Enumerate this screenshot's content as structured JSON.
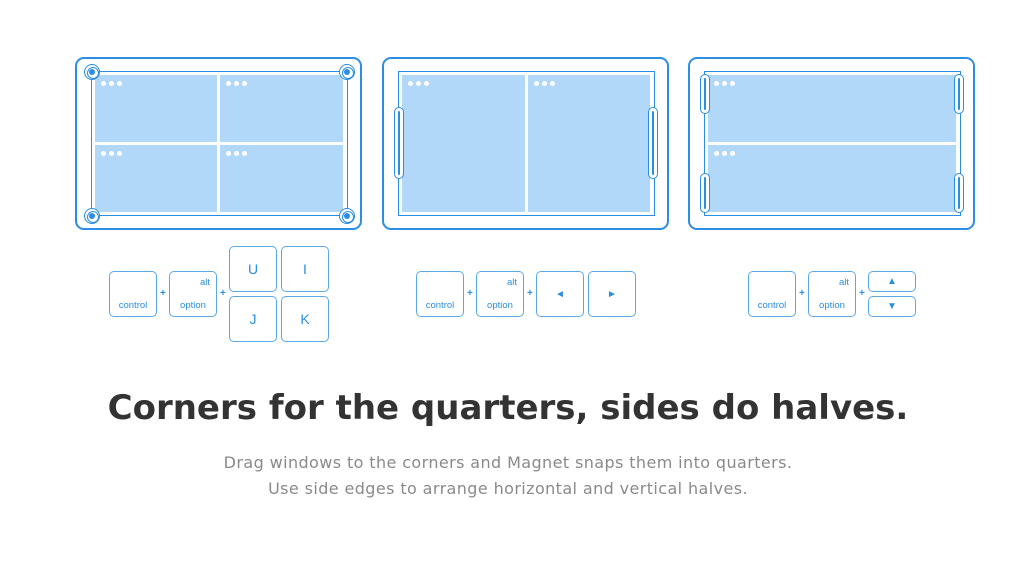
{
  "panels": {
    "quarters": {
      "windows": 4
    },
    "halves_vertical": {
      "windows": 2
    },
    "halves_horizontal": {
      "windows": 2
    }
  },
  "shortcuts": {
    "quarters": {
      "modifiers": [
        {
          "top": "",
          "bottom": "control"
        },
        {
          "top": "alt",
          "bottom": "option"
        }
      ],
      "keys": [
        "U",
        "I",
        "J",
        "K"
      ]
    },
    "halves_vertical": {
      "modifiers": [
        {
          "top": "",
          "bottom": "control"
        },
        {
          "top": "alt",
          "bottom": "option"
        }
      ],
      "keys": [
        "◄",
        "►"
      ]
    },
    "halves_horizontal": {
      "modifiers": [
        {
          "top": "",
          "bottom": "control"
        },
        {
          "top": "alt",
          "bottom": "option"
        }
      ],
      "keys": [
        "▲",
        "▼"
      ]
    },
    "plus": "+"
  },
  "headline": "Corners for the quarters, sides do halves.",
  "description": {
    "line1": "Drag windows to the corners and Magnet snaps them into quarters.",
    "line2": "Use side edges to arrange horizontal and vertical halves."
  },
  "colors": {
    "accent": "#2b8de3",
    "window_fill": "#b1d8f8",
    "headline": "#333333",
    "body_text": "#8a8a8a"
  }
}
